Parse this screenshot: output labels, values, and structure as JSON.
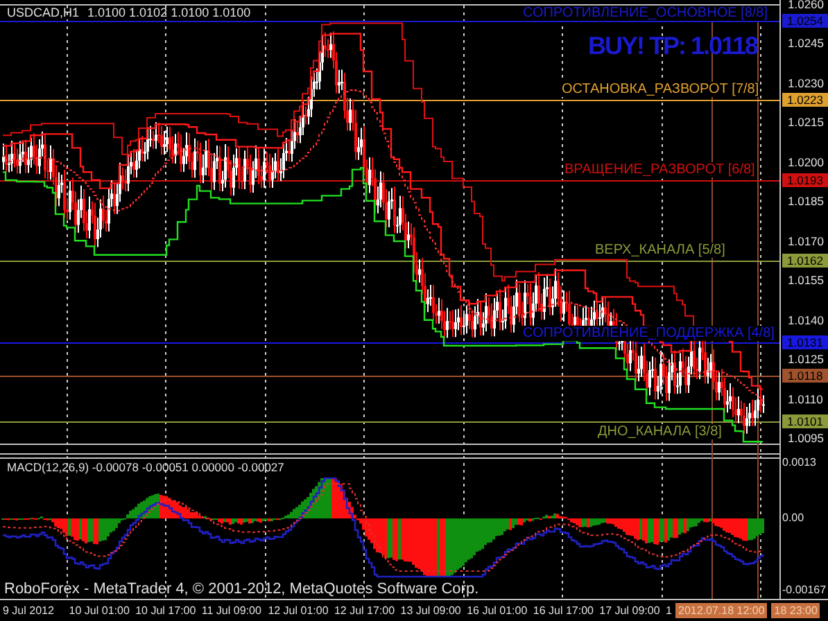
{
  "chart": {
    "symbol": "USDCAD,H1",
    "ohlc": "1.0100 1.0102 1.0100 1.0100"
  },
  "signal": "BUY! TP: 1.0118",
  "levels": [
    {
      "label": "СОПРОТИВЛЕНИЕ_ОСНОВНОЕ [8/8]",
      "tag": "1.0254",
      "color": "#1a1ad0"
    },
    {
      "label": "ОСТАНОВКА_РАЗВОРОТ [7/8]",
      "tag": "1.0223",
      "color": "#e0a030"
    },
    {
      "label": "ВРАЩЕНИЕ_РАЗВОРОТ [6/8]",
      "tag": "1.0193",
      "color": "#d01010"
    },
    {
      "label": "ВЕРХ_КАНАЛА [5/8]",
      "tag": "1.0162",
      "color": "#8c9a3a"
    },
    {
      "label": "СОПРОТИВЛЕНИЕ_ПОДДЕРЖКА [4/8]",
      "tag": "1.0131",
      "color": "#1818e0"
    },
    {
      "tag": "1.0118",
      "color": "#a0522d"
    },
    {
      "label": "ДНО_КАНАЛА [3/8]",
      "tag": "1.0101",
      "color": "#8c9a3a"
    }
  ],
  "price_axis": [
    "1.0260",
    "1.0245",
    "1.0230",
    "1.0215",
    "1.0200",
    "1.0185",
    "1.0170",
    "1.0155",
    "1.0140",
    "1.0125",
    "1.0110",
    "1.0095"
  ],
  "macd": {
    "label": "MACD(12,26,9) -0.00078 -0.00051 0.00000 -0.00027",
    "axis": [
      "0.0013",
      "0.00",
      "-0.00167"
    ]
  },
  "copyright": "RoboForex - MetaTrader 4, © 2001-2012, MetaQuotes Software Corp.",
  "time_axis": [
    "9 Jul 2012",
    "10 Jul 01:00",
    "10 Jul 17:00",
    "11 Jul 09:00",
    "12 Jul 01:00",
    "12 Jul 17:00",
    "13 Jul 09:00",
    "16 Jul 01:00",
    "16 Jul 17:00",
    "17 Jul 09:00",
    "1"
  ],
  "time_markers": [
    "2012.07.18 12:00",
    "18 23:00"
  ]
}
